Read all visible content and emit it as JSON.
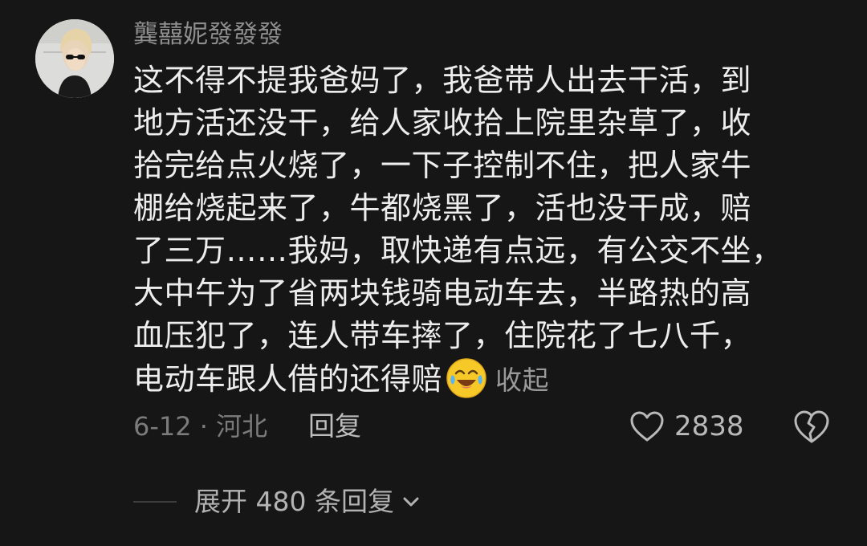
{
  "comment": {
    "username": "龔囍妮發發發",
    "avatar_icon": "avatar-photo",
    "lines": [
      "这不得不提我爸妈了，我爸带人出去干活，到",
      "地方活还没干，给人家收拾上院里杂草了，收",
      "拾完给点火烧了，一下子控制不住，把人家牛",
      "棚给烧起来了，牛都烧黑了，活也没干成，赔",
      "了三万……我妈，取快递有点远，有公交不坐，",
      "大中午为了省两块钱骑电动车去，半路热的高",
      "血压犯了，连人带车摔了，住院花了七八千，",
      "电动车跟人借的还得赔"
    ],
    "emoji": "crying-laughing-emoji",
    "collapse_label": "收起",
    "date_location": "6-12 · 河北",
    "reply_label": "回复",
    "like_icon": "heart-icon",
    "like_count": "2838",
    "dislike_icon": "broken-heart-icon",
    "expand_replies_label": "展开 480 条回复",
    "expand_icon": "chevron-down-icon"
  },
  "colors": {
    "background": "#161616",
    "text_primary": "#ededed",
    "text_secondary": "#8e8e8e",
    "emoji_yellow": "#f7c928"
  }
}
